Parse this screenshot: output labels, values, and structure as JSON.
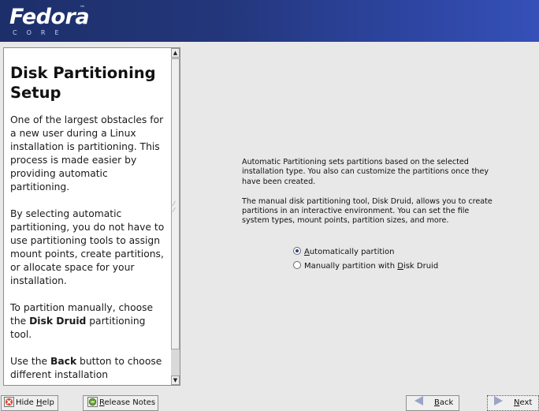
{
  "banner": {
    "logo_word": "Fedora",
    "logo_tm": "™",
    "logo_sub": "CORE"
  },
  "help": {
    "title": "Disk Partitioning Setup",
    "para1": "One of the largest obstacles for a new user during a Linux installation is partitioning. This process is made easier by providing automatic partitioning.",
    "para2": "By selecting automatic partitioning, you do not have to use partitioning tools to assign mount points, create partitions, or allocate space for your installation.",
    "para3_before": "To partition manually, choose the ",
    "para3_bold": "Disk Druid",
    "para3_after": " partitioning tool.",
    "para4_before": "Use the ",
    "para4_bold": "Back",
    "para4_after": " button to choose different installation"
  },
  "main": {
    "para1": "Automatic Partitioning sets partitions based on the selected installation type. You also can customize the partitions once they have been created.",
    "para2": "The manual disk partitioning tool, Disk Druid, allows you to create partitions in an interactive environment. You can set the file system types, mount points, partition sizes, and more.",
    "radio_auto": {
      "mnemonic": "A",
      "rest": "utomatically partition",
      "checked": true
    },
    "radio_manual": {
      "before": "Manually partition with ",
      "mnemonic": "D",
      "rest": "isk Druid",
      "checked": false
    }
  },
  "buttons": {
    "hide_help": {
      "before": "Hide ",
      "mnemonic": "H",
      "rest": "elp"
    },
    "release_notes": {
      "mnemonic": "R",
      "rest": "elease Notes"
    },
    "back": {
      "mnemonic": "B",
      "rest": "ack"
    },
    "next": {
      "mnemonic": "N",
      "rest": "ext"
    }
  },
  "colors": {
    "banner": "#23367a",
    "radio_dot": "#2a3f8f"
  }
}
